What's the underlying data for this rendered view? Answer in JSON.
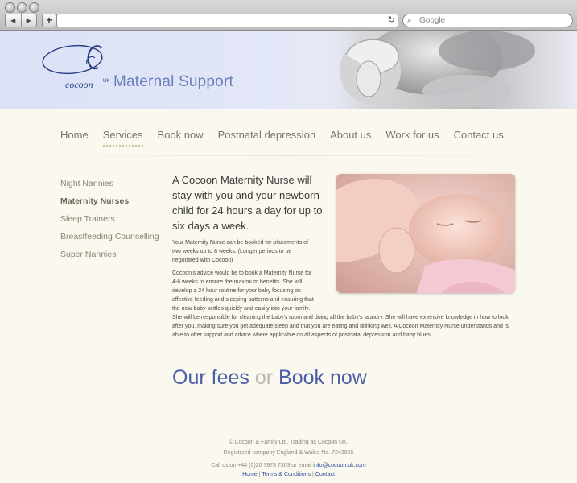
{
  "browser": {
    "nav_back": "◀",
    "nav_forward": "▶",
    "new_tab": "+",
    "reload_icon": "↻",
    "search_icon": "⌕",
    "search_placeholder": "Google"
  },
  "header": {
    "logo_name": "cocoon",
    "logo_uk": "UK",
    "tagline": "Maternal Support"
  },
  "nav": {
    "items": [
      "Home",
      "Services",
      "Book now",
      "Postnatal depression",
      "About us",
      "Work for us",
      "Contact us"
    ],
    "active": "Services"
  },
  "side_menu": {
    "items": [
      "Night Nannies",
      "Maternity Nurses",
      "Sleep Trainers",
      "Breastfeeding Counselling",
      "Super Nannies"
    ],
    "active": "Maternity Nurses"
  },
  "main": {
    "intro": "A Cocoon Maternity Nurse will stay with you and your newborn child for 24 hours a day for up to six days a week.",
    "para1": "Your Maternity Nurse can be booked for placements of two weeks up to 8 weeks. (Longer periods to be negotiated with Cocoon)",
    "para2_narrow": "Cocoon's advice would be to book a Maternity Nurse for 4-6 weeks to ensure the maximum benefits. She will develop a 24 hour routine for your baby focusing on effective feeding and sleeping patterns and ensuring that the new baby settles quickly and easily into your family.",
    "para2_wide": "She will be responsible for cleaning the baby's room and doing all the baby's laundry. She will have extensive knowledge in how to look after you, making sure you get adequate sleep and that you are eating and drinking well. A Cocoon Maternity Nurse understands and is able to offer support and advice where applicable on all aspects of postnatal depression and baby blues.",
    "fees_label": "Our fees",
    "or_label": "or",
    "book_label": "Book now"
  },
  "footer": {
    "line1": "© Cocoon & Family Ltd. Trading as Cocoon UK.",
    "line2": "Registered company England & Wales No. 7243065",
    "line3_prefix": "Call us on +44 (0)20 7978 7303 or email",
    "email": "info@cocoon.uk.com",
    "link_home": "Home",
    "link_terms": "Terms & Conditions",
    "link_contact": "Contact",
    "sep": "|"
  }
}
